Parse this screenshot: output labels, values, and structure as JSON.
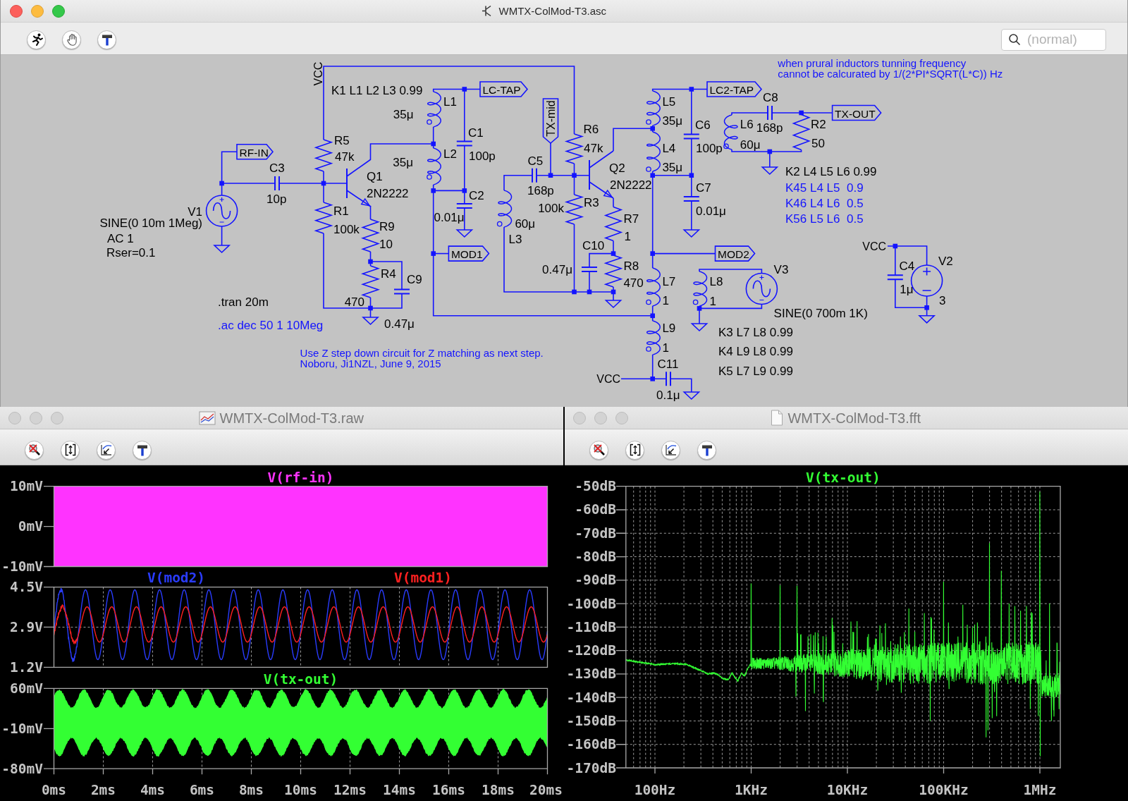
{
  "schematic_window": {
    "title": "WMTX-ColMod-T3.asc",
    "search": {
      "placeholder": "(normal)"
    }
  },
  "schematic": {
    "components": [
      {
        "kind": "inductor",
        "ref": "L1",
        "values": [
          "35μ"
        ]
      },
      {
        "kind": "inductor",
        "ref": "L5",
        "values": [
          "35μ"
        ]
      },
      {
        "kind": "capacitor",
        "ref": "C8",
        "values": [
          "168p"
        ]
      },
      {
        "kind": "resistor",
        "ref": "R5",
        "values": [
          "47k"
        ]
      },
      {
        "kind": "inductor",
        "ref": "L2",
        "values": [
          "35μ"
        ]
      },
      {
        "kind": "capacitor",
        "ref": "C1",
        "values": [
          "100p"
        ]
      },
      {
        "kind": "resistor",
        "ref": "R6",
        "values": [
          "47k"
        ]
      },
      {
        "kind": "capacitor",
        "ref": "C6",
        "values": [
          "100p"
        ]
      },
      {
        "kind": "inductor",
        "ref": "L6",
        "values": [
          "60μ"
        ]
      },
      {
        "kind": "resistor",
        "ref": "R2",
        "values": [
          "50"
        ]
      },
      {
        "kind": "capacitor",
        "ref": "C3",
        "values": [
          "10p"
        ]
      },
      {
        "kind": "npn",
        "ref": "Q1",
        "values": [
          "2N2222"
        ]
      },
      {
        "kind": "capacitor",
        "ref": "C5",
        "values": [
          "168p"
        ]
      },
      {
        "kind": "npn",
        "ref": "Q2",
        "values": [
          "2N2222"
        ]
      },
      {
        "kind": "inductor",
        "ref": "L4",
        "values": [
          "35μ"
        ]
      },
      {
        "kind": "sine_source",
        "ref": "V1",
        "values": [
          "SINE(0 10m 1Meg)",
          "AC 1",
          "Rser=0.1"
        ]
      },
      {
        "kind": "resistor",
        "ref": "R1",
        "values": [
          "100k"
        ]
      },
      {
        "kind": "capacitor",
        "ref": "C2",
        "values": [
          "0.01μ"
        ]
      },
      {
        "kind": "resistor",
        "ref": "R3",
        "values": [
          "100k"
        ]
      },
      {
        "kind": "capacitor",
        "ref": "C7",
        "values": [
          "0.01μ"
        ]
      },
      {
        "kind": "resistor",
        "ref": "R9",
        "values": [
          "10"
        ]
      },
      {
        "kind": "inductor",
        "ref": "L3",
        "values": [
          "60μ"
        ]
      },
      {
        "kind": "resistor",
        "ref": "R7",
        "values": [
          "1"
        ]
      },
      {
        "kind": "resistor",
        "ref": "R4",
        "values": [
          "470"
        ]
      },
      {
        "kind": "capacitor",
        "ref": "C9",
        "values": [
          "0.47μ"
        ]
      },
      {
        "kind": "capacitor",
        "ref": "C10",
        "values": [
          "0.47μ"
        ]
      },
      {
        "kind": "resistor",
        "ref": "R8",
        "values": [
          "470"
        ]
      },
      {
        "kind": "inductor",
        "ref": "L7",
        "values": [
          "1"
        ]
      },
      {
        "kind": "inductor",
        "ref": "L8",
        "values": [
          "1"
        ]
      },
      {
        "kind": "sine_source",
        "ref": "V3",
        "values": [
          "SINE(0 700m 1K)"
        ]
      },
      {
        "kind": "capacitor",
        "ref": "C4",
        "values": [
          "1μ"
        ]
      },
      {
        "kind": "dc_source",
        "ref": "V2",
        "values": [
          "3"
        ]
      },
      {
        "kind": "inductor",
        "ref": "L9",
        "values": [
          "1"
        ]
      },
      {
        "kind": "capacitor",
        "ref": "C11",
        "values": [
          "0.1μ"
        ]
      }
    ],
    "net_flags": [
      "LC-TAP",
      "LC2-TAP",
      "TX-mid",
      "TX-OUT",
      "RF-IN",
      "MOD1",
      "MOD2"
    ],
    "net_labels": [
      "VCC",
      "VCC",
      "VCC"
    ],
    "texts": [
      {
        "kind": "comment",
        "lines": [
          "when prural inductors tunning frequency",
          "cannot be calcurated by 1/(2*PI*SQRT(L*C)) Hz"
        ]
      },
      {
        "kind": "directive",
        "lines": [
          "K1 L1 L2 L3 0.99"
        ]
      },
      {
        "kind": "directive",
        "lines": [
          "K2 L4 L5 L6 0.99"
        ]
      },
      {
        "kind": "comment",
        "lines": [
          "K45 L4 L5  0.9"
        ]
      },
      {
        "kind": "comment",
        "lines": [
          "K46 L4 L6  0.5"
        ]
      },
      {
        "kind": "comment",
        "lines": [
          "K56 L5 L6  0.5"
        ]
      },
      {
        "kind": "directive",
        "lines": [
          ".tran 20m"
        ]
      },
      {
        "kind": "comment",
        "lines": [
          ".ac dec 50 1 10Meg"
        ]
      },
      {
        "kind": "directive",
        "lines": [
          "K3 L7 L8 0.99"
        ]
      },
      {
        "kind": "comment",
        "lines": [
          "Use Z step down circuit for Z matching as next step.",
          "Noboru, Ji1NZL, June 9, 2015"
        ]
      },
      {
        "kind": "directive",
        "lines": [
          "K4 L9 L8 0.99"
        ]
      },
      {
        "kind": "directive",
        "lines": [
          "K5 L7 L9 0.99"
        ]
      }
    ]
  },
  "waveform_window": {
    "title": "WMTX-ColMod-T3.raw",
    "panes": [
      {
        "traces": [
          {
            "name": "V(rf-in)",
            "color": "#ff33ff",
            "kind": "band"
          }
        ],
        "y_ticks": [
          "10mV",
          "0mV",
          "-10mV"
        ]
      },
      {
        "traces": [
          {
            "name": "V(mod2)",
            "color": "#2a3cff",
            "kind": "wave"
          },
          {
            "name": "V(mod1)",
            "color": "#ff2020",
            "kind": "wave"
          }
        ],
        "y_ticks": [
          "4.5V",
          "2.9V",
          "1.2V"
        ]
      },
      {
        "traces": [
          {
            "name": "V(tx-out)",
            "color": "#33ff33",
            "kind": "modulated"
          }
        ],
        "y_ticks": [
          "60mV",
          "-10mV",
          "-80mV"
        ]
      }
    ],
    "x_ticks": [
      "0ms",
      "2ms",
      "4ms",
      "6ms",
      "8ms",
      "10ms",
      "12ms",
      "14ms",
      "16ms",
      "18ms",
      "20ms"
    ]
  },
  "fft_window": {
    "title": "WMTX-ColMod-T3.fft",
    "traces": [
      {
        "name": "V(tx-out)",
        "color": "#33ff33",
        "kind": "spectrum"
      }
    ],
    "y_ticks": [
      "-50dB",
      "-60dB",
      "-70dB",
      "-80dB",
      "-90dB",
      "-100dB",
      "-110dB",
      "-120dB",
      "-130dB",
      "-140dB",
      "-150dB",
      "-160dB",
      "-170dB"
    ],
    "x_ticks": [
      "100Hz",
      "1KHz",
      "10KHz",
      "100KHz",
      "1MHz"
    ]
  }
}
